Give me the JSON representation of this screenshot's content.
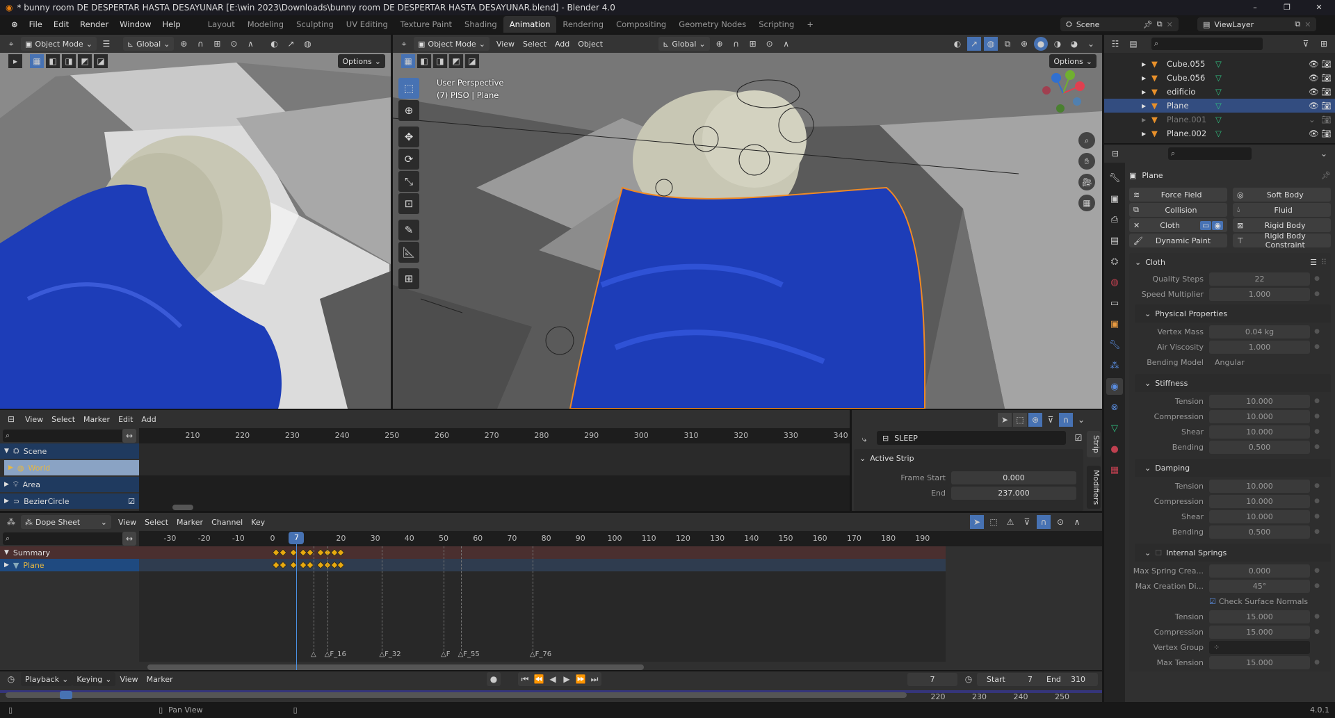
{
  "window": {
    "title": "* bunny room DE DESPERTAR HASTA DESAYUNAR [E:\\win 2023\\Downloads\\bunny room DE DESPERTAR HASTA DESAYUNAR.blend] - Blender 4.0"
  },
  "topbar": {
    "menus": [
      "File",
      "Edit",
      "Render",
      "Window",
      "Help"
    ],
    "workspaces": [
      {
        "label": "Layout"
      },
      {
        "label": "Modeling"
      },
      {
        "label": "Sculpting"
      },
      {
        "label": "UV Editing"
      },
      {
        "label": "Texture Paint"
      },
      {
        "label": "Shading"
      },
      {
        "label": "Animation",
        "active": true
      },
      {
        "label": "Rendering"
      },
      {
        "label": "Compositing"
      },
      {
        "label": "Geometry Nodes"
      },
      {
        "label": "Scripting"
      }
    ],
    "add_workspace": "+",
    "scene": "Scene",
    "view_layer": "ViewLayer"
  },
  "left_viewport": {
    "mode": "Object Mode",
    "orientation": "Global",
    "options": "Options"
  },
  "right_viewport": {
    "mode": "Object Mode",
    "menus": [
      "View",
      "Select",
      "Add",
      "Object"
    ],
    "orientation": "Global",
    "options": "Options",
    "overlay_line1": "User Perspective",
    "overlay_line2": "(7) PISO | Plane"
  },
  "colors": {
    "accent": "#4772b3",
    "keyframe": "#e8a90f",
    "selection_outline": "#f08a24",
    "blanket": "#1d3db8"
  },
  "outliner": {
    "items": [
      {
        "name": "Cube.055"
      },
      {
        "name": "Cube.056"
      },
      {
        "name": "edificio"
      },
      {
        "name": "Plane",
        "selected": true
      },
      {
        "name": "Plane.001",
        "dimmed": true
      },
      {
        "name": "Plane.002"
      }
    ]
  },
  "properties": {
    "object_name": "Plane",
    "physics_buttons": [
      [
        "Force Field",
        "Soft Body"
      ],
      [
        "Collision",
        "Fluid"
      ],
      [
        "Cloth",
        "Rigid Body"
      ],
      [
        "Dynamic Paint",
        "Rigid Body Constraint"
      ]
    ],
    "cloth": {
      "title": "Cloth",
      "rows": [
        {
          "label": "Quality Steps",
          "value": "22"
        },
        {
          "label": "Speed Multiplier",
          "value": "1.000"
        }
      ],
      "sections": [
        {
          "title": "Physical Properties",
          "rows": [
            {
              "label": "Vertex Mass",
              "value": "0.04 kg"
            },
            {
              "label": "Air Viscosity",
              "value": "1.000"
            },
            {
              "label": "Bending Model",
              "value": "Angular",
              "type": "dropdown"
            }
          ]
        },
        {
          "title": "Stiffness",
          "rows": [
            {
              "label": "Tension",
              "value": "10.000"
            },
            {
              "label": "Compression",
              "value": "10.000"
            },
            {
              "label": "Shear",
              "value": "10.000"
            },
            {
              "label": "Bending",
              "value": "0.500"
            }
          ]
        },
        {
          "title": "Damping",
          "rows": [
            {
              "label": "Tension",
              "value": "10.000"
            },
            {
              "label": "Compression",
              "value": "10.000"
            },
            {
              "label": "Shear",
              "value": "10.000"
            },
            {
              "label": "Bending",
              "value": "0.500"
            }
          ]
        },
        {
          "title": "Internal Springs",
          "checkbox": false,
          "rows": [
            {
              "label": "Max Spring Crea...",
              "value": "0.000"
            },
            {
              "label": "Max Creation Di...",
              "value": "45°"
            },
            {
              "label": "",
              "value": "Check Surface Normals",
              "type": "checkbox",
              "checked": true
            },
            {
              "label": "Tension",
              "value": "15.000"
            },
            {
              "label": "Compression",
              "value": "15.000"
            },
            {
              "label": "Vertex Group",
              "value": "",
              "type": "field"
            },
            {
              "label": "Max Tension",
              "value": "15.000"
            }
          ]
        }
      ]
    }
  },
  "nla": {
    "menus": [
      "View",
      "Select",
      "Marker",
      "Edit",
      "Add"
    ],
    "ruler": [
      210,
      220,
      230,
      240,
      250,
      260,
      270,
      280,
      290,
      300,
      310,
      320,
      330,
      340
    ],
    "channels": [
      {
        "name": "Scene",
        "expanded": true
      },
      {
        "name": "World",
        "highlight": true
      },
      {
        "name": "Area"
      },
      {
        "name": "BezierCircle",
        "checked": true
      }
    ],
    "strip_panel": {
      "action": "SLEEP",
      "panel_title": "Active Strip",
      "frame_start_label": "Frame Start",
      "frame_start": "0.000",
      "end_label": "End",
      "end": "237.000",
      "tabs": [
        "Strip",
        "Modifiers"
      ]
    }
  },
  "dopesheet": {
    "mode": "Dope Sheet",
    "menus": [
      "View",
      "Select",
      "Marker",
      "Channel",
      "Key"
    ],
    "ruler": [
      -30,
      -20,
      -10,
      0,
      10,
      20,
      30,
      40,
      50,
      60,
      70,
      80,
      90,
      100,
      110,
      120,
      130,
      140,
      150,
      160,
      170,
      180,
      190
    ],
    "current_frame": 7,
    "channels": [
      {
        "name": "Summary"
      },
      {
        "name": "Plane"
      }
    ],
    "keyframes": [
      1,
      3,
      6,
      9,
      11,
      14,
      16,
      18,
      20
    ],
    "markers": [
      {
        "frame": 12,
        "name": ""
      },
      {
        "frame": 16,
        "name": "F_16"
      },
      {
        "frame": 32,
        "name": "F_32"
      },
      {
        "frame": 50,
        "name": "F"
      },
      {
        "frame": 55,
        "name": "F_55"
      },
      {
        "frame": 76,
        "name": "F_76"
      }
    ]
  },
  "timeline": {
    "menus": [
      "Playback",
      "Keying",
      "View",
      "Marker"
    ],
    "current_frame": "7",
    "start_label": "Start",
    "start": "7",
    "end_label": "End",
    "end": "310",
    "ruler_visible": [
      220,
      230,
      240,
      250
    ]
  },
  "status": {
    "hint": "Pan View",
    "version": "4.0.1"
  }
}
